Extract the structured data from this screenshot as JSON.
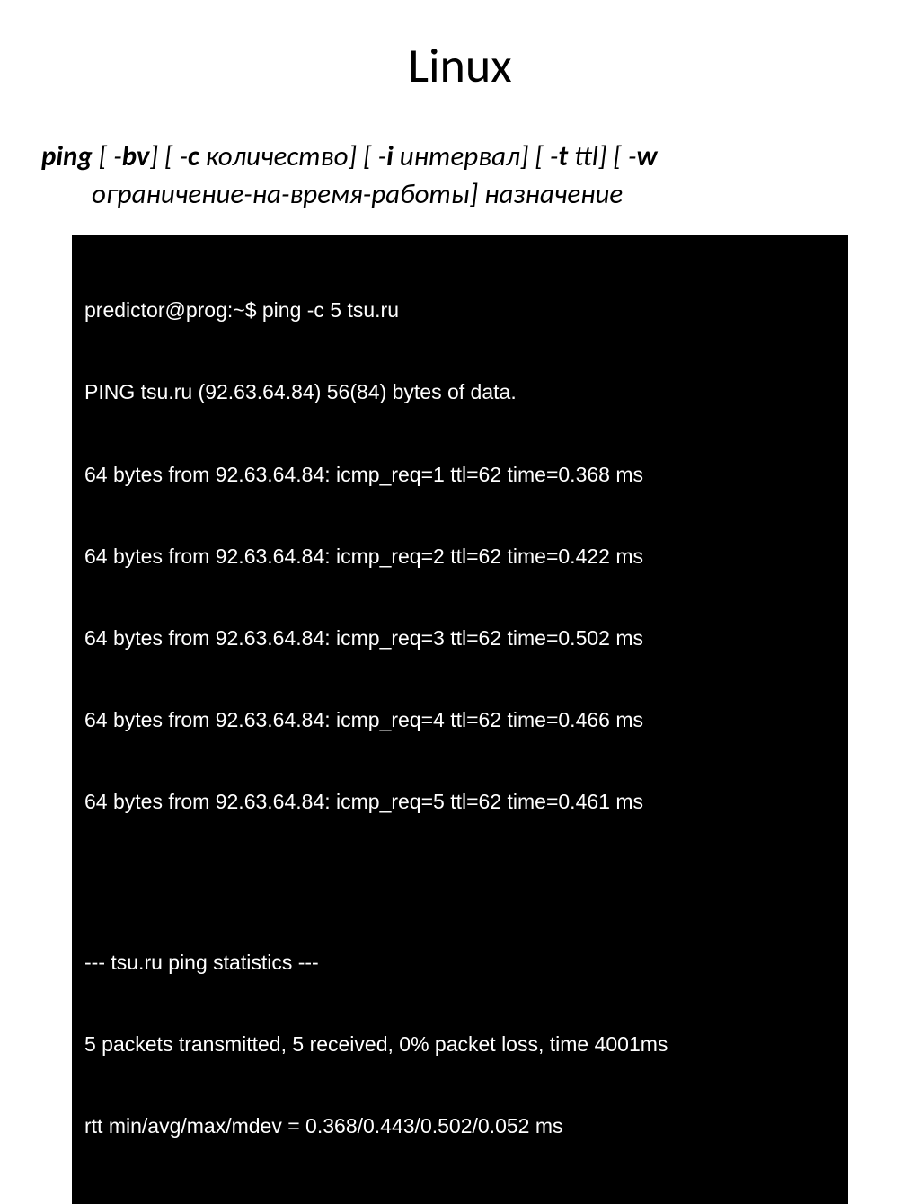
{
  "title": "Linux",
  "syntax": {
    "ping": "ping",
    "opt_bv": " [ -",
    "bv": "bv",
    "close1": "]",
    "opt_c": " [ -",
    "c": "c",
    "count": " количество]",
    "opt_i": " [ -",
    "i_flag": "i",
    "interval": " интервал]",
    "opt_t": " [ -",
    "t": "t",
    "ttl": " ttl]",
    "opt_w": " [ -",
    "w": "w",
    "line2": "ограничение-на-время-работы] назначение"
  },
  "terminal": {
    "l1": "predictor@prog:~$ ping -c 5 tsu.ru",
    "l2": "PING tsu.ru (92.63.64.84) 56(84) bytes of data.",
    "l3": "64 bytes from 92.63.64.84: icmp_req=1 ttl=62 time=0.368 ms",
    "l4": "64 bytes from 92.63.64.84: icmp_req=2 ttl=62 time=0.422 ms",
    "l5": "64 bytes from 92.63.64.84: icmp_req=3 ttl=62 time=0.502 ms",
    "l6": "64 bytes from 92.63.64.84: icmp_req=4 ttl=62 time=0.466 ms",
    "l7": "64 bytes from 92.63.64.84: icmp_req=5 ttl=62 time=0.461 ms",
    "l8": "--- tsu.ru ping statistics ---",
    "l9": "5 packets transmitted, 5 received, 0% packet loss, time 4001ms",
    "l10": "rtt min/avg/max/mdev = 0.368/0.443/0.502/0.052 ms"
  }
}
